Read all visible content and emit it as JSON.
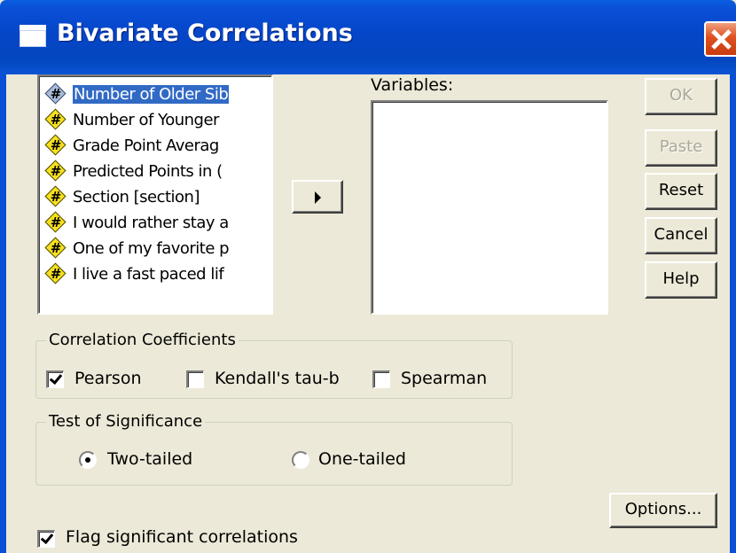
{
  "window": {
    "title": "Bivariate Correlations"
  },
  "source_list": {
    "items": [
      {
        "label": "Number of Older Sib",
        "icon": "scale-variable-icon",
        "selected": true
      },
      {
        "label": "Number of Younger",
        "icon": "scale-variable-icon",
        "selected": false
      },
      {
        "label": "Grade Point Averag",
        "icon": "scale-variable-icon",
        "selected": false
      },
      {
        "label": "Predicted Points in (",
        "icon": "scale-variable-icon",
        "selected": false
      },
      {
        "label": "Section [section]",
        "icon": "scale-variable-icon",
        "selected": false
      },
      {
        "label": "I would rather stay a",
        "icon": "scale-variable-icon",
        "selected": false
      },
      {
        "label": "One of my favorite p",
        "icon": "scale-variable-icon",
        "selected": false
      },
      {
        "label": "I live a fast paced lif",
        "icon": "scale-variable-icon",
        "selected": false
      }
    ]
  },
  "target": {
    "label": "Variables:",
    "items": []
  },
  "buttons": {
    "ok": "OK",
    "paste": "Paste",
    "reset": "Reset",
    "cancel": "Cancel",
    "help": "Help",
    "options": "Options..."
  },
  "correlation_coefficients": {
    "title": "Correlation Coefficients",
    "pearson": {
      "label": "Pearson",
      "checked": true
    },
    "kendall": {
      "label": "Kendall's tau-b",
      "checked": false
    },
    "spearman": {
      "label": "Spearman",
      "checked": false
    }
  },
  "test_of_significance": {
    "title": "Test of Significance",
    "two_tailed": {
      "label": "Two-tailed",
      "selected": true
    },
    "one_tailed": {
      "label": "One-tailed",
      "selected": false
    }
  },
  "flag": {
    "label": "Flag significant correlations",
    "checked": true
  },
  "colors": {
    "titlebar": "#0a4fd6",
    "face": "#ece9d8",
    "selection": "#316ac5"
  }
}
